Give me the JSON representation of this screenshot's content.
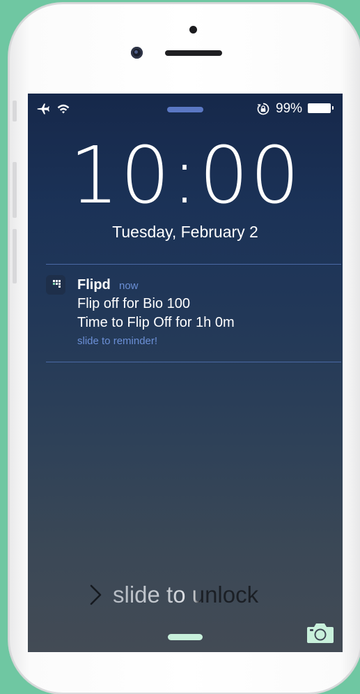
{
  "status_bar": {
    "battery_percent": "99%",
    "icons": [
      "airplane-icon",
      "wifi-icon",
      "rotation-lock-icon",
      "battery-icon"
    ]
  },
  "lock_screen": {
    "time": "10:00",
    "date": "Tuesday, February 2"
  },
  "notification": {
    "app_name": "Flipd",
    "time": "now",
    "line1": "Flip off for Bio 100",
    "line2": "Time to Flip Off for 1h 0m",
    "action_hint": "slide to reminder!",
    "icon": "flipd-app-icon"
  },
  "unlock": {
    "label": "slide to unlock",
    "icon": "chevron-right-icon"
  },
  "colors": {
    "background": "#6fc7a2",
    "accent_link": "#6b8fd6",
    "grabber": "#5b78c4",
    "home_bar": "#c8f0db",
    "camera_icon": "#c8f0db"
  }
}
